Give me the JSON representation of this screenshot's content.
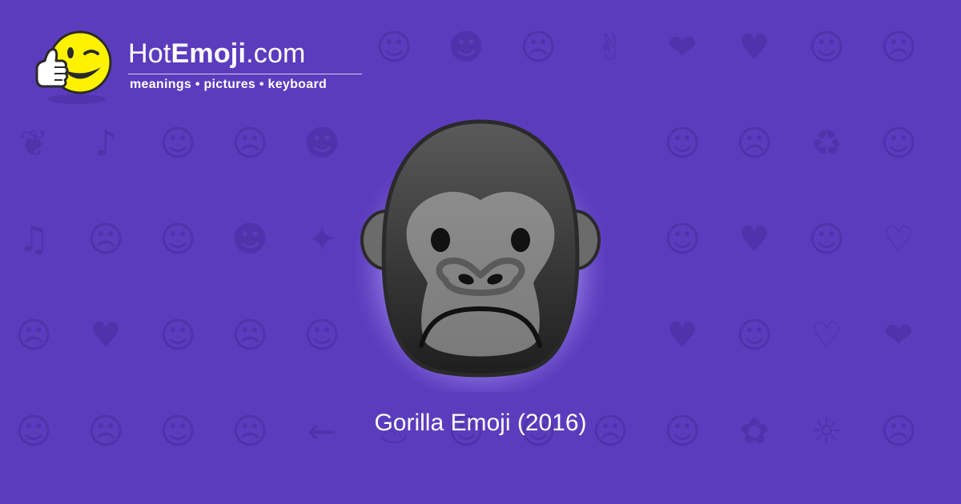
{
  "brand": {
    "name_prefix": "Hot",
    "name_bold": "Emoji",
    "name_suffix": ".com",
    "tagline": "meanings • pictures • keyboard"
  },
  "main": {
    "emoji_name": "gorilla-icon",
    "caption": "Gorilla Emoji (2016)"
  },
  "colors": {
    "background": "#5b3cbd",
    "pattern": "#4f33aa",
    "text": "#ffffff"
  },
  "background_pattern": [
    "☺",
    "☻",
    "☹",
    "✌",
    "❤",
    "♥",
    "☺",
    "☹",
    "❦",
    "♪",
    "☺",
    "☹",
    "☻",
    "☺",
    "☹",
    "♻",
    "☺",
    "♫",
    "☹",
    "☺",
    "☻",
    "✦",
    "☺",
    "♥",
    "☺",
    "♡",
    "☹",
    "♥",
    "☺",
    "☹",
    "☺",
    "♥",
    "☺",
    "♡",
    "❤",
    "☺",
    "☹",
    "☺",
    "☹",
    "←",
    "♨",
    "☺",
    "☺",
    "☹",
    "☺",
    "✿",
    "☼",
    "☹",
    "♥",
    "✔",
    "☺",
    "☻",
    "☺",
    "✋",
    "☺",
    "☹",
    "☹",
    "♥",
    "♥",
    "☺"
  ]
}
